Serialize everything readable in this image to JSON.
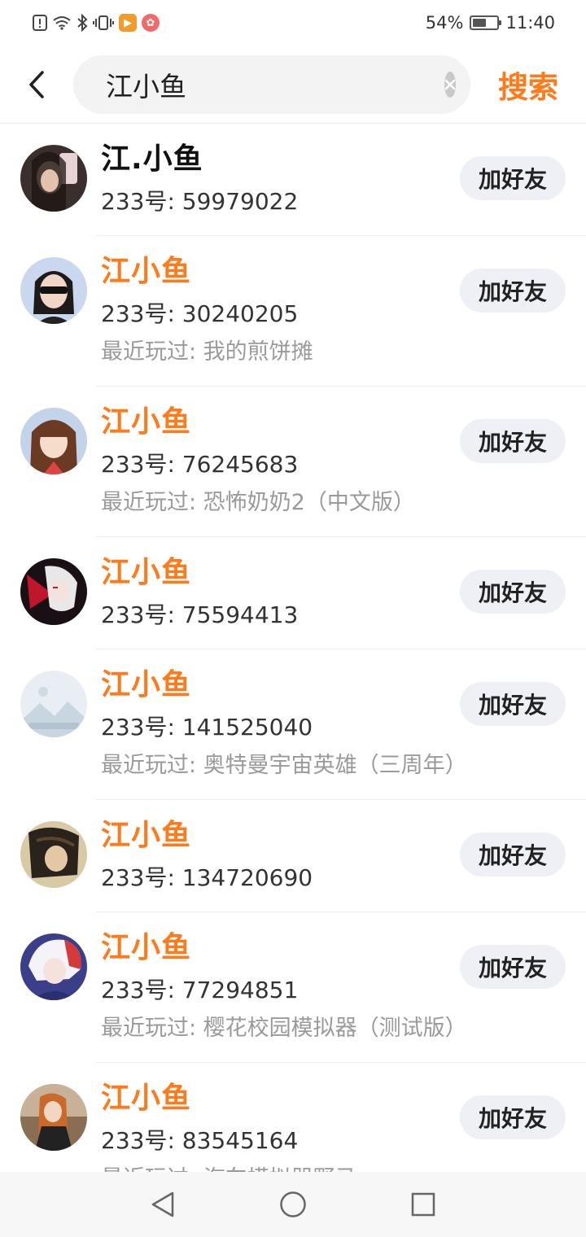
{
  "status_bar": {
    "battery": "54%",
    "time": "11:40",
    "battery_level": 0.54
  },
  "search": {
    "query": "江小鱼",
    "submit_label": "搜索"
  },
  "results": [
    {
      "name": "江.小鱼",
      "highlight": false,
      "uid": "233号: 59979022",
      "recent": ""
    },
    {
      "name": "江小鱼",
      "highlight": true,
      "uid": "233号: 30240205",
      "recent": "最近玩过: 我的煎饼摊"
    },
    {
      "name": "江小鱼",
      "highlight": true,
      "uid": "233号: 76245683",
      "recent": "最近玩过: 恐怖奶奶2（中文版）"
    },
    {
      "name": "江小鱼",
      "highlight": true,
      "uid": "233号: 75594413",
      "recent": ""
    },
    {
      "name": "江小鱼",
      "highlight": true,
      "uid": "233号: 141525040",
      "recent": "最近玩过: 奥特曼宇宙英雄（三周年）"
    },
    {
      "name": "江小鱼",
      "highlight": true,
      "uid": "233号: 134720690",
      "recent": ""
    },
    {
      "name": "江小鱼",
      "highlight": true,
      "uid": "233号: 77294851",
      "recent": "最近玩过: 樱花校园模拟器（测试版）"
    },
    {
      "name": "江小鱼",
      "highlight": true,
      "uid": "233号: 83545164",
      "recent": "最近玩过: 汽车模拟器野马"
    }
  ],
  "add_friend_label": "加好友",
  "colors": {
    "accent": "#ff7a1a",
    "button_bg": "#eef0f5",
    "muted_text": "#9a9a9a"
  },
  "nav": {
    "back": "back-triangle-icon",
    "home": "home-circle-icon",
    "recents": "recents-square-icon"
  }
}
